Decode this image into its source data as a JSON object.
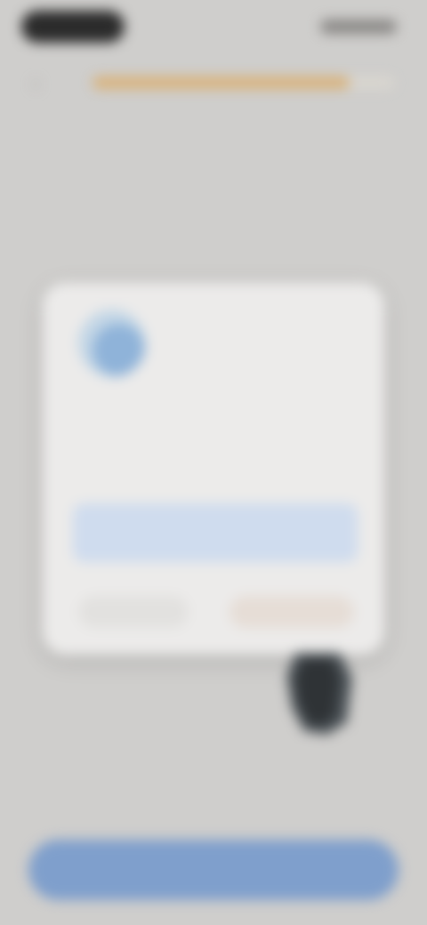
{
  "status": {
    "time": "",
    "indicators": ""
  },
  "progress": {
    "fraction": 0.85,
    "color": "#d9b27a"
  },
  "header": {
    "title": "",
    "subtitle": ""
  },
  "card": {
    "logo": "app-logo",
    "heading": "",
    "text": "",
    "link_box": "",
    "left_button": "",
    "right_button": ""
  },
  "footer": {
    "continue_label": "",
    "accent": "#7f9fcc"
  }
}
